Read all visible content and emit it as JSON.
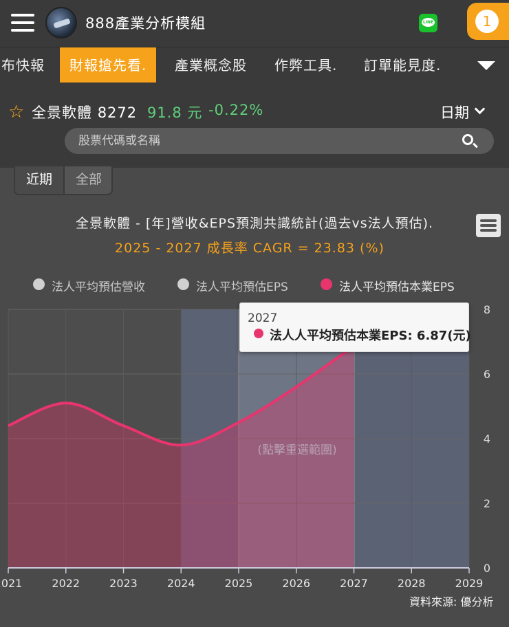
{
  "header": {
    "app_title": "888產業分析模組",
    "line_icon_text": "LINE",
    "notification_count": "1"
  },
  "tabs": [
    {
      "label": "布快報"
    },
    {
      "label": "財報搶先看.",
      "active": true
    },
    {
      "label": "產業概念股"
    },
    {
      "label": "作弊工具."
    },
    {
      "label": "訂單能見度."
    }
  ],
  "stock": {
    "name": "全景軟體",
    "code": "8272",
    "price": "91.8 元",
    "change": "-0.22%",
    "price_color": "#5fd07a",
    "date_label": "日期"
  },
  "search": {
    "placeholder": "股票代碼或名稱"
  },
  "range": {
    "recent": "近期",
    "all": "全部"
  },
  "chart": {
    "title": "全景軟體 - [年]營收&EPS預測共識統計(過去vs法人預估).",
    "subtitle": "2025 - 2027 成長率 CAGR = 23.83 (%)",
    "hint": "(點擊重選範圍)",
    "source": "資料來源: 優分析",
    "legend": [
      {
        "label": "法人平均預估營收",
        "color": "#d0d0d0"
      },
      {
        "label": "法人平均預估EPS",
        "color": "#d0d0d0"
      },
      {
        "label": "法人平均預估本業EPS",
        "color": "#e8356e"
      }
    ],
    "tooltip": {
      "year": "2027",
      "text": "法人人平均預估本業EPS: 6.87(元)"
    }
  },
  "chart_data": {
    "type": "area",
    "title": "全景軟體 - [年]營收&EPS預測共識統計(過去vs法人預估).",
    "x": [
      2021,
      2022,
      2023,
      2024,
      2025,
      2026,
      2027
    ],
    "series": [
      {
        "name": "法人平均預估本業EPS",
        "values": [
          4.4,
          5.1,
          4.4,
          3.8,
          4.5,
          5.6,
          6.87
        ],
        "color": "#e8356e"
      }
    ],
    "x_ticks": [
      "2021",
      "2022",
      "2023",
      "2024",
      "2025",
      "2026",
      "2027",
      "2028",
      "2029"
    ],
    "y_ticks": [
      "0",
      "2",
      "4",
      "6",
      "8"
    ],
    "xlim": [
      2021,
      2029
    ],
    "ylim": [
      0,
      8
    ],
    "highlight_range": [
      2024,
      2029
    ],
    "selection_range": [
      2025,
      2027
    ],
    "grid": true,
    "legend_position": "top"
  }
}
